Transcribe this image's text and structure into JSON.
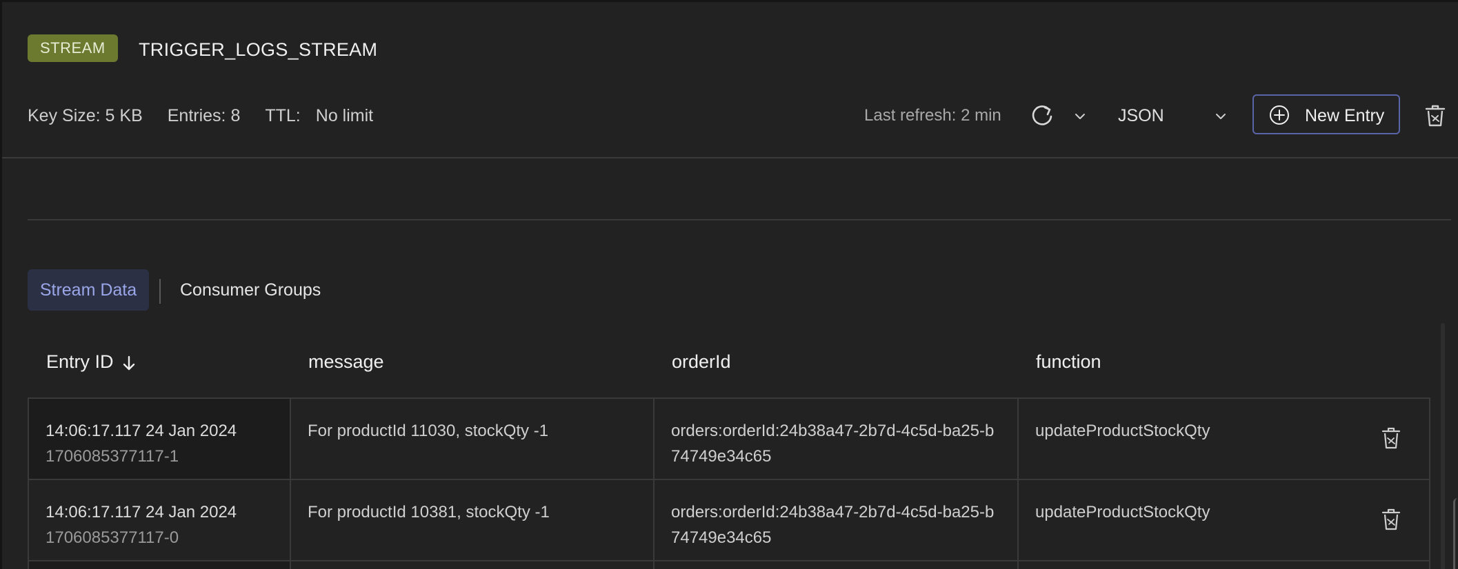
{
  "header": {
    "badge": "STREAM",
    "key_name": "TRIGGER_LOGS_STREAM",
    "key_size": "Key Size: 5 KB",
    "entries": "Entries: 8",
    "ttl_label": "TTL:",
    "ttl_value": "No limit",
    "last_refresh": "Last refresh: 2 min",
    "format": "JSON",
    "new_entry_label": "New Entry"
  },
  "tabs": {
    "active": "Stream Data",
    "inactive": "Consumer Groups"
  },
  "table": {
    "columns": [
      "Entry ID",
      "message",
      "orderId",
      "function"
    ],
    "rows": [
      {
        "timestamp": "14:06:17.117 24 Jan 2024",
        "entry_id": "1706085377117-1",
        "message": "For productId 11030, stockQty -1",
        "order_id": "orders:orderId:24b38a47-2b7d-4c5d-ba25-b74749e34c65",
        "function": "updateProductStockQty"
      },
      {
        "timestamp": "14:06:17.117 24 Jan 2024",
        "entry_id": "1706085377117-0",
        "message": "For productId 10381, stockQty -1",
        "order_id": "orders:orderId:24b38a47-2b7d-4c5d-ba25-b74749e34c65",
        "function": "updateProductStockQty"
      }
    ]
  },
  "colors": {
    "background": "#222222",
    "badge": "#6b7a2e",
    "accent": "#5a64a8",
    "active_tab_text": "#9aa6e8"
  },
  "icons": {
    "refresh": "refresh-icon",
    "chevron": "chevron-down-icon",
    "plus": "plus-circle-icon",
    "delete": "trash-icon",
    "sort": "arrow-down-icon"
  }
}
